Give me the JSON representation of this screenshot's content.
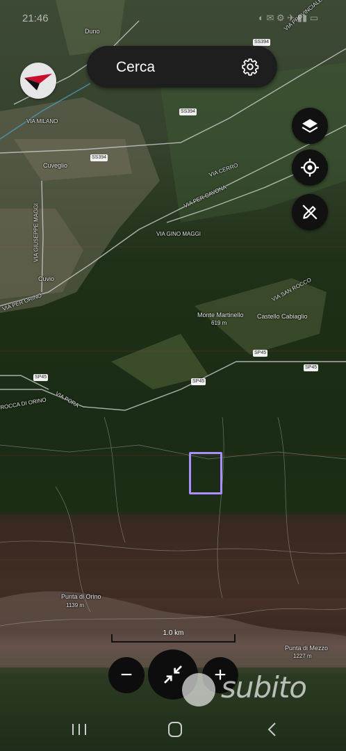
{
  "status_bar": {
    "time": "21:46",
    "icons": "◐ ✉ ⚙      ✈ ▮▮ ▭"
  },
  "search": {
    "label": "Cerca"
  },
  "map": {
    "labels": [
      {
        "text": "Duno"
      },
      {
        "text": "VIA PROVINCIALE"
      },
      {
        "text": "VIA MILANO"
      },
      {
        "text": "Cuveglio"
      },
      {
        "text": "VIA GIUSEPPE MAGGI"
      },
      {
        "text": "Cuvio"
      },
      {
        "text": "VIA PER ORINO"
      },
      {
        "text": "VIA CERRO"
      },
      {
        "text": "VIA PER CAVONA"
      },
      {
        "text": "VIA GINO MAGGI"
      },
      {
        "text": "VIA SAN ROCCO"
      },
      {
        "text": "Monte Martinello"
      },
      {
        "text": "619 m"
      },
      {
        "text": "Castello Cabiaglio"
      },
      {
        "text": "ROCCA DI ORINO"
      },
      {
        "text": "VIA PORA"
      },
      {
        "text": "Punta di Orino"
      },
      {
        "text": "1139 m"
      },
      {
        "text": "Punta di Mezzo"
      },
      {
        "text": "1227 m"
      }
    ],
    "shields": [
      "SS394",
      "SS394",
      "SS394",
      "SP45",
      "SP45",
      "SP45",
      "SP45"
    ]
  },
  "scale": {
    "label": "1.0 km"
  },
  "zoom": {
    "out_label": "−",
    "in_label": "+"
  },
  "watermark": {
    "text": "subito"
  },
  "icons": {
    "compass": "compass-icon",
    "settings": "gear-icon",
    "layers": "layers-icon",
    "locate": "crosshair-icon",
    "tools": "edit-off-icon",
    "center": "collapse-arrows-icon"
  }
}
